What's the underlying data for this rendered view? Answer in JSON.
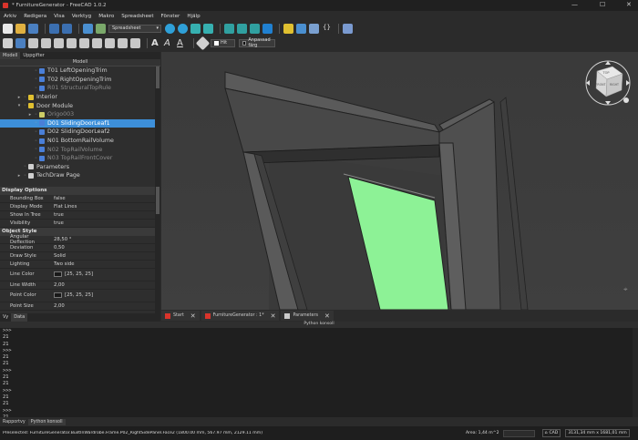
{
  "window": {
    "title": "* FurnitureGenerator - FreeCAD 1.0.2"
  },
  "menu": [
    "Arkiv",
    "Redigera",
    "Visa",
    "Verktyg",
    "Makro",
    "Spreadsheet",
    "Fönster",
    "Hjälp"
  ],
  "toolbar": {
    "workbench": "Spreadsheet",
    "color_value": "Hit",
    "aligned_label": "Anpassad färg"
  },
  "left_panel": {
    "tabs": [
      "Modell",
      "Uppgifter"
    ],
    "tree_header": "Modell",
    "tree": [
      {
        "label": "T01 LeftOpeningTrim",
        "icon": "part-icon",
        "gray": false,
        "expand": ""
      },
      {
        "label": "T02 RightOpeningTrim",
        "icon": "part-icon",
        "gray": false,
        "expand": ""
      },
      {
        "label": "R01 StructuralTopRule",
        "icon": "part-icon",
        "gray": true,
        "expand": ""
      },
      {
        "label": "Interior",
        "icon": "folder-icon",
        "gray": false,
        "expand": "▸"
      },
      {
        "label": "Door Module",
        "icon": "folder-icon",
        "gray": false,
        "expand": "▾"
      },
      {
        "label": "Origo003",
        "icon": "origin-icon",
        "gray": true,
        "expand": "▸"
      },
      {
        "label": "D01 SlidingDoorLeaf1",
        "icon": "part-icon",
        "gray": false,
        "expand": "",
        "selected": true
      },
      {
        "label": "D02 SlidingDoorLeaf2",
        "icon": "part-icon",
        "gray": false,
        "expand": ""
      },
      {
        "label": "N01 BottomRailVolume",
        "icon": "part-icon",
        "gray": false,
        "expand": ""
      },
      {
        "label": "N02 TopRailVolume",
        "icon": "part-icon",
        "gray": true,
        "expand": ""
      },
      {
        "label": "N03 TopRailFrontCover",
        "icon": "part-icon",
        "gray": true,
        "expand": ""
      },
      {
        "label": "Parameters",
        "icon": "sheet-icon",
        "gray": false,
        "expand": ""
      },
      {
        "label": "TechDraw Page",
        "icon": "page-icon",
        "gray": false,
        "expand": "▸"
      }
    ],
    "properties": {
      "display_options": "Display Options",
      "object_style": "Object Style",
      "rows_display": [
        {
          "k": "Bounding Box",
          "v": "false"
        },
        {
          "k": "Display Mode",
          "v": "Flat Lines"
        },
        {
          "k": "Show In Tree",
          "v": "true"
        },
        {
          "k": "Visibility",
          "v": "true"
        }
      ],
      "rows_style": [
        {
          "k": "Angular Deflection",
          "v": "28,50 °"
        },
        {
          "k": "Deviation",
          "v": "0,50"
        },
        {
          "k": "Draw Style",
          "v": "Solid"
        },
        {
          "k": "Lighting",
          "v": "Two side"
        },
        {
          "k": "Line Color",
          "v": "[25, 25, 25]",
          "swatch": "#191919"
        },
        {
          "k": "Line Width",
          "v": "2,00"
        },
        {
          "k": "Point Color",
          "v": "[25, 25, 25]",
          "swatch": "#191919"
        },
        {
          "k": "Point Size",
          "v": "2,00"
        }
      ]
    },
    "bottom_tabs": [
      "Vy",
      "Data"
    ]
  },
  "view_tabs": [
    {
      "label": "Start",
      "icon_color": "#d9342b"
    },
    {
      "label": "FurnitureGenerator : 1*",
      "icon_color": "#d9342b"
    },
    {
      "label": "Parameters",
      "icon_color": "#cccccc"
    }
  ],
  "navcube": {
    "top": "TOP",
    "front": "FRONT",
    "right": "RIGHT"
  },
  "python_console": {
    "title": "Python konsoll",
    "lines": [
      ">>>",
      "21",
      "21",
      ">>>",
      "21",
      "21",
      ">>>",
      "21",
      "21",
      ">>>",
      "21",
      "21",
      ">>>",
      "21",
      "21",
      ">>>",
      "21",
      ">>>"
    ]
  },
  "bottom_tabs": [
    "Rapportvy",
    "Python konsoll"
  ],
  "status": {
    "preselected": "Preselected: FurnitureGenerator.BuiltInWardrobe.Frame.P02_RightSidePanel.Face2 (1800.00 mm, 567.97 mm, 2129.11 mm)",
    "area": "Area: 1,44 m^2",
    "nav_style": "CAD",
    "dimensions": "3131,34 mm x 1681,01 mm"
  },
  "colors": {
    "accent": "#3d8fd9",
    "door_panel": "#8df296",
    "background": "#2b2b2b"
  }
}
